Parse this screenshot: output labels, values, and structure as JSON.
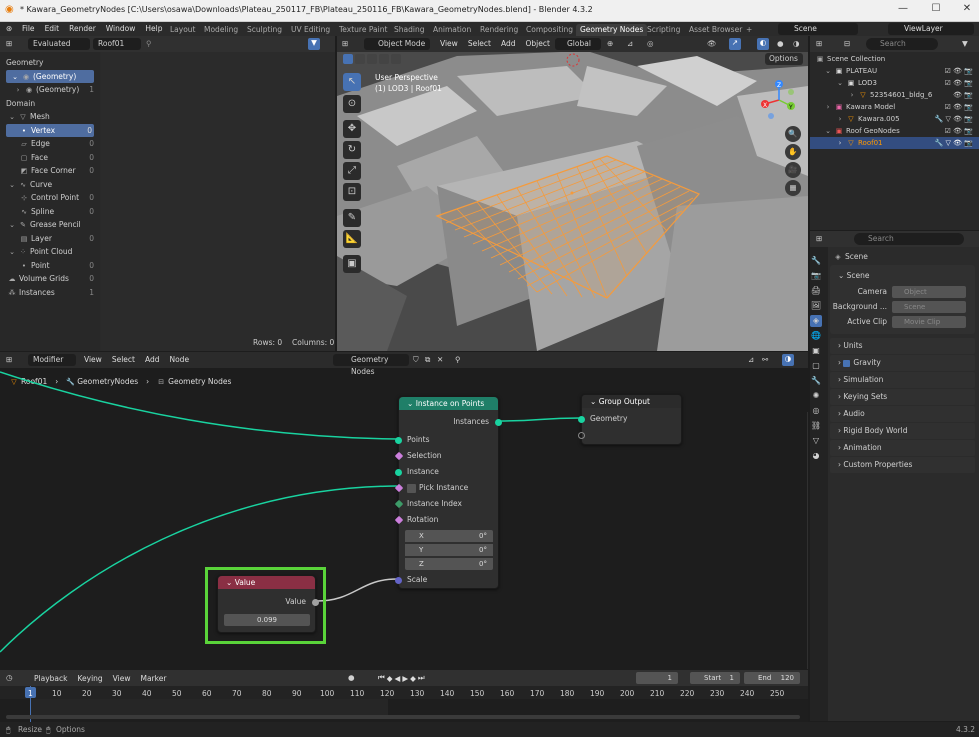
{
  "window": {
    "title": "* Kawara_GeometryNodes [C:\\Users\\osawa\\Downloads\\Plateau_250117_FB\\Plateau_250116_FB\\Kawara_GeometryNodes.blend] - Blender 4.3.2",
    "minimize": "—",
    "maximize": "☐",
    "close": "✕"
  },
  "menu": [
    "File",
    "Edit",
    "Render",
    "Window",
    "Help"
  ],
  "workspaces": [
    "Layout",
    "Modeling",
    "Sculpting",
    "UV Editing",
    "Texture Paint",
    "Shading",
    "Animation",
    "Rendering",
    "Compositing",
    "Geometry Nodes",
    "Scripting",
    "Asset Browser"
  ],
  "active_workspace": "Geometry Nodes",
  "scene": "Scene",
  "viewlayer": "ViewLayer",
  "spreadsheet": {
    "mode": "Evaluated",
    "object": "Roof01",
    "sec_geometry": "Geometry",
    "geo1": "(Geometry)",
    "geo2": "(Geometry)",
    "geo2n": "1",
    "sec_domain": "Domain",
    "items": [
      [
        "Mesh",
        ""
      ],
      [
        "Vertex",
        "0"
      ],
      [
        "Edge",
        "0"
      ],
      [
        "Face",
        "0"
      ],
      [
        "Face Corner",
        "0"
      ],
      [
        "Curve",
        ""
      ],
      [
        "Control Point",
        "0"
      ],
      [
        "Spline",
        "0"
      ],
      [
        "Grease Pencil",
        ""
      ],
      [
        "Layer",
        "0"
      ],
      [
        "Point Cloud",
        ""
      ],
      [
        "Point",
        "0"
      ],
      [
        "Volume Grids",
        "0"
      ],
      [
        "Instances",
        "1"
      ]
    ],
    "rows": "Rows: 0",
    "cols": "Columns: 0"
  },
  "viewport": {
    "mode": "Object Mode",
    "menu": [
      "View",
      "Select",
      "Add",
      "Object"
    ],
    "orient": "Global",
    "options": "Options",
    "persp": "User Perspective",
    "coll": "(1) LOD3 | Roof01"
  },
  "outliner": {
    "search": "Search",
    "items": [
      "Scene Collection",
      "PLATEAU",
      "LOD3",
      "52354601_bldg_6",
      "Kawara Model",
      "Kawara.005",
      "Roof GeoNodes",
      "Roof01"
    ]
  },
  "props": {
    "search": "Search",
    "scene": "Scene",
    "panel": "Scene",
    "camera": "Camera",
    "camera_val": "Object",
    "bg": "Background ...",
    "bg_val": "Scene",
    "clip": "Active Clip",
    "clip_val": "Movie Clip",
    "sections": [
      "Units",
      "Gravity",
      "Simulation",
      "Keying Sets",
      "Audio",
      "Rigid Body World",
      "Animation",
      "Custom Properties"
    ]
  },
  "nodeeditor": {
    "editor": "Modifier",
    "menu": [
      "View",
      "Select",
      "Add",
      "Node"
    ],
    "tree": "Geometry Nodes",
    "crumbs": [
      "Roof01",
      "GeometryNodes",
      "Geometry Nodes"
    ]
  },
  "nodes": {
    "iop": {
      "title": "Instance on Points",
      "out": "Instances",
      "in": [
        "Points",
        "Selection",
        "Instance",
        "Pick Instance",
        "Instance Index",
        "Rotation"
      ],
      "x": "X",
      "y": "Y",
      "z": "Z",
      "rx": "0°",
      "ry": "0°",
      "rz": "0°",
      "scale": "Scale"
    },
    "go": {
      "title": "Group Output",
      "in": "Geometry"
    },
    "val": {
      "title": "Value",
      "out": "Value",
      "value": "0.099"
    }
  },
  "timeline": {
    "menu": [
      "Playback",
      "Keying",
      "View",
      "Marker"
    ],
    "current": "1",
    "start_l": "Start",
    "start": "1",
    "end_l": "End",
    "end": "120",
    "ticks": [
      "1",
      "10",
      "20",
      "30",
      "40",
      "50",
      "60",
      "70",
      "80",
      "90",
      "100",
      "110",
      "120",
      "130",
      "140",
      "150",
      "160",
      "170",
      "180",
      "190",
      "200",
      "210",
      "220",
      "230",
      "240",
      "250"
    ]
  },
  "status": {
    "left": "Resize",
    "left2": "Options",
    "version": "4.3.2"
  },
  "colors": {
    "accent": "#4772b3",
    "iop_header": "#1f7f68",
    "val_header": "#8a2f44",
    "highlight": "#5ad43a",
    "link": "#19d3a0"
  }
}
